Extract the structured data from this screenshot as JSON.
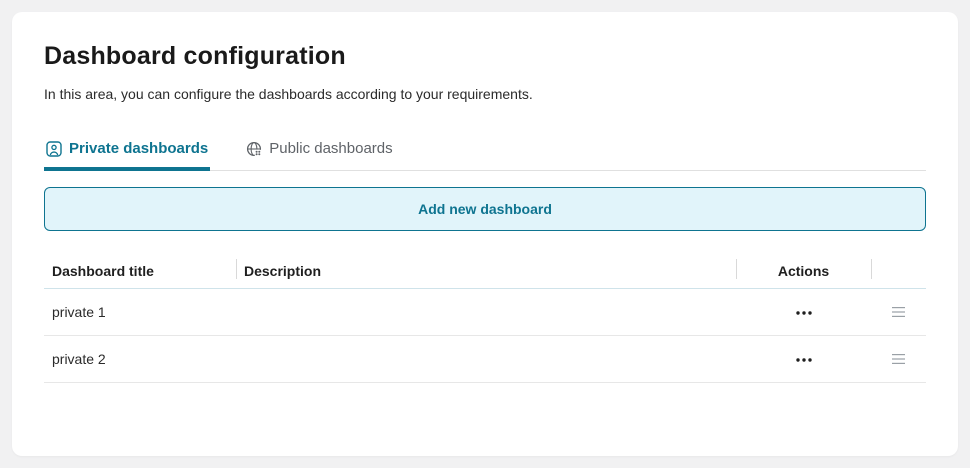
{
  "page": {
    "title": "Dashboard configuration",
    "subtitle": "In this area, you can configure the dashboards according to your requirements."
  },
  "tabs": [
    {
      "label": "Private dashboards",
      "icon": "user-badge-icon",
      "active": true
    },
    {
      "label": "Public dashboards",
      "icon": "globe-icon",
      "active": false
    }
  ],
  "add_button": {
    "label": "Add new dashboard"
  },
  "table": {
    "columns": [
      "Dashboard title",
      "Description",
      "Actions",
      ""
    ],
    "rows": [
      {
        "title": "private 1",
        "description": "",
        "actions_icon": "ellipsis-icon",
        "drag_icon": "drag-handle-icon"
      },
      {
        "title": "private 2",
        "description": "",
        "actions_icon": "ellipsis-icon",
        "drag_icon": "drag-handle-icon"
      }
    ]
  },
  "colors": {
    "accent": "#0e7490",
    "accent_background": "#e1f4fa",
    "page_background": "#f1f1f2",
    "card_background": "#ffffff",
    "inactive_tab_text": "#5f6368",
    "header_divider": "#cfe3ea",
    "row_divider": "#e7e7e7"
  }
}
